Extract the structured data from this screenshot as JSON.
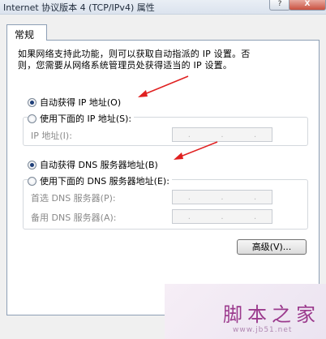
{
  "window": {
    "title": "Internet 协议版本 4 (TCP/IPv4) 属性",
    "help_button": "?",
    "close_button": "X"
  },
  "tabs": [
    {
      "label": "常规"
    }
  ],
  "description": {
    "line1": "如果网络支持此功能，则可以获取自动指派的 IP 设置。否",
    "line2": "则，您需要从网络系统管理员处获得适当的 IP 设置。"
  },
  "ip": {
    "auto_label": "自动获得 IP 地址(O)",
    "manual_label": "使用下面的 IP 地址(S):",
    "address_label": "IP 地址(I):",
    "selected": "auto"
  },
  "dns": {
    "auto_label": "自动获得 DNS 服务器地址(B)",
    "manual_label": "使用下面的 DNS 服务器地址(E):",
    "preferred_label": "首选 DNS 服务器(P):",
    "alternate_label": "备用 DNS 服务器(A):",
    "selected": "auto"
  },
  "buttons": {
    "advanced": "高级(V)..."
  },
  "watermark": {
    "site_name": "脚本之家",
    "url": "www.jb51.net"
  },
  "colors": {
    "annotation_arrow": "#e02020",
    "radio_dot": "#1f3f78"
  }
}
